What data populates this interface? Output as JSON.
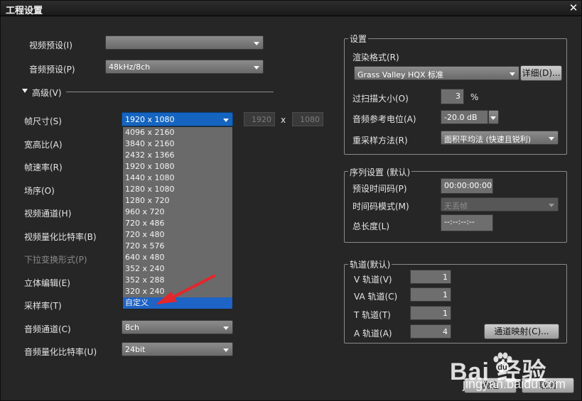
{
  "window": {
    "title": "工程设置",
    "close": "✕"
  },
  "left": {
    "video_preset_label": "视频预设(I)",
    "video_preset_value": "",
    "audio_preset_label": "音频预设(P)",
    "audio_preset_value": "48kHz/8ch",
    "advanced_label": "高级(V)",
    "frame_size_label": "帧尺寸(S)",
    "frame_size_value": "1920 x 1080",
    "frame_width": "1920",
    "frame_x": "x",
    "frame_height": "1080",
    "aspect_label": "宽高比(A)",
    "frame_rate_label": "帧速率(R)",
    "field_order_label": "场序(O)",
    "video_channel_label": "视频通道(H)",
    "video_bit_label": "视频量化比特率(B)",
    "pulldown_label": "下拉变换形式(P)",
    "stereo_label": "立体编辑(E)",
    "sample_rate_label": "采样率(T)",
    "audio_channel_label": "音频通道(C)",
    "audio_channel_value": "8ch",
    "audio_bit_label": "音频量化比特率(U)",
    "audio_bit_value": "24bit"
  },
  "frame_size_options": [
    "4096 x 2160",
    "3840 x 2160",
    "2432 x 1366",
    "1920 x 1080",
    "1440 x 1080",
    "1280 x 1080",
    "1280 x 720",
    "960 x 720",
    "720 x 486",
    "720 x 480",
    "720 x 576",
    "640 x 480",
    "352 x 240",
    "352 x 288",
    "320 x 240",
    "自定义"
  ],
  "settings": {
    "group_label": "设置",
    "render_format_label": "渲染格式(R)",
    "render_format_value": "Grass Valley HQX 标准",
    "detail_button": "详细(D)...",
    "overscan_label": "过扫描大小(O)",
    "overscan_value": "3",
    "overscan_unit": "%",
    "audio_ref_label": "音频参考电位(A)",
    "audio_ref_value": "-20.0 dB",
    "resample_label": "重采样方法(R)",
    "resample_value": "面积平均法 (快速且锐利)"
  },
  "sequence": {
    "group_label": "序列设置 (默认)",
    "preset_tc_label": "预设时间码(P)",
    "preset_tc_value": "00:00:00:00",
    "tc_mode_label": "时间码模式(M)",
    "tc_mode_value": "无丢帧",
    "total_length_label": "总长度(L)",
    "total_length_value": "--:--:--:--"
  },
  "tracks": {
    "group_label": "轨道(默认)",
    "v_label": "V 轨道(V)",
    "v_value": "1",
    "va_label": "VA 轨道(C)",
    "va_value": "1",
    "t_label": "T 轨道(T)",
    "t_value": "1",
    "a_label": "A 轨道(A)",
    "a_value": "4",
    "channel_map_button": "通道映射(C)..."
  },
  "footer": {
    "ok_button": "确定",
    "cancel_button": "取消"
  },
  "watermark": {
    "brand": "Bai  经验",
    "url": "jingyan.baidu.com"
  }
}
